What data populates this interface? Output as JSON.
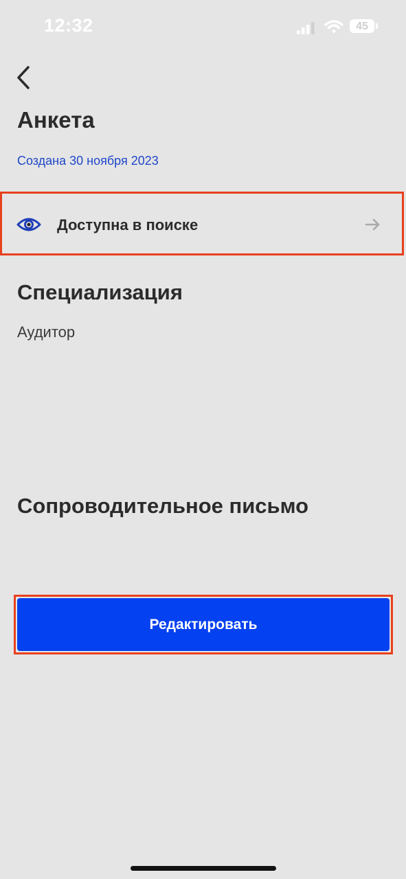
{
  "status_bar": {
    "time": "12:32",
    "battery_level": "45",
    "icons": [
      "signal-icon",
      "wifi-icon",
      "battery-icon"
    ]
  },
  "navigation": {
    "back_icon": "chevron-left-icon"
  },
  "header": {
    "title": "Анкета",
    "created": "Создана 30 ноября 2023"
  },
  "visibility": {
    "label": "Доступна в поиске",
    "icon": "eye-icon",
    "action_icon": "arrow-right-icon"
  },
  "specialization": {
    "title": "Специализация",
    "value": "Аудитор"
  },
  "cover_letter": {
    "title": "Сопроводительное письмо"
  },
  "actions": {
    "edit_label": "Редактировать"
  },
  "colors": {
    "background": "#e5e5e5",
    "accent": "#0441f0",
    "link": "#1f47c9",
    "highlight": "#e8401e",
    "text": "#2b2b2b"
  }
}
